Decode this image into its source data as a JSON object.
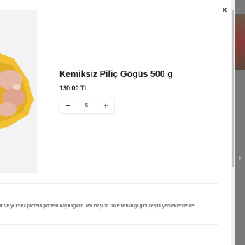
{
  "modal": {
    "close_icon": "×",
    "product": {
      "title": "Kemiksiz Piliç Göğüs 500 g",
      "price": "130,00 TL",
      "image_icon": "chicken-breast-image"
    },
    "stepper": {
      "decrement": "−",
      "quantity": "5",
      "increment": "+"
    },
    "description": "ir ve yüksek protein protein kaynağıdır. Tek başına tüketilebildiği gibi çeşitli yemeklerde de"
  },
  "backdrop": {
    "arrow_icon": "›"
  },
  "colors": {
    "text": "#222222",
    "image_bg": "#f3f3f3",
    "tray": "#f2c030",
    "meat": "#e8b6a4"
  }
}
